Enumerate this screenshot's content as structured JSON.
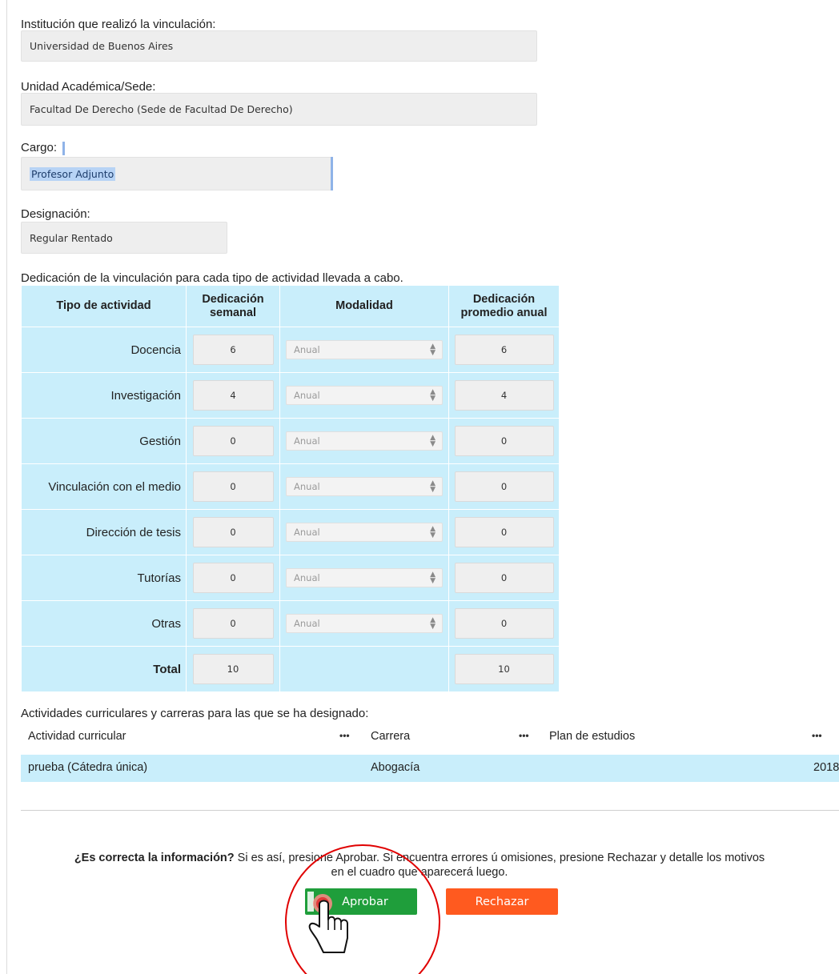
{
  "form": {
    "institucion": {
      "label": "Institución que realizó la vinculación:",
      "value": "Universidad de Buenos Aires"
    },
    "unidad": {
      "label": "Unidad Académica/Sede:",
      "value": "Facultad De Derecho (Sede de Facultad De Derecho)"
    },
    "cargo": {
      "label": "Cargo:",
      "value": "Profesor Adjunto"
    },
    "designacion": {
      "label": "Designación:",
      "value": "Regular Rentado"
    }
  },
  "dedication": {
    "caption": "Dedicación de la vinculación para cada tipo de actividad llevada a cabo.",
    "headers": {
      "tipo": "Tipo de actividad",
      "semanal_1": "Dedicación",
      "semanal_2": "semanal",
      "modalidad": "Modalidad",
      "anual_1": "Dedicación",
      "anual_2": "promedio anual"
    },
    "rows": [
      {
        "actividad": "Docencia",
        "semanal": "6",
        "modalidad": "Anual",
        "anual": "6"
      },
      {
        "actividad": "Investigación",
        "semanal": "4",
        "modalidad": "Anual",
        "anual": "4"
      },
      {
        "actividad": "Gestión",
        "semanal": "0",
        "modalidad": "Anual",
        "anual": "0"
      },
      {
        "actividad": "Vinculación con el medio",
        "semanal": "0",
        "modalidad": "Anual",
        "anual": "0"
      },
      {
        "actividad": "Dirección de tesis",
        "semanal": "0",
        "modalidad": "Anual",
        "anual": "0"
      },
      {
        "actividad": "Tutorías",
        "semanal": "0",
        "modalidad": "Anual",
        "anual": "0"
      },
      {
        "actividad": "Otras",
        "semanal": "0",
        "modalidad": "Anual",
        "anual": "0"
      }
    ],
    "total": {
      "label": "Total",
      "semanal": "10",
      "anual": "10"
    }
  },
  "curricular": {
    "caption": "Actividades curriculares y carreras para las que se ha designado:",
    "columns": {
      "actividad": "Actividad curricular",
      "carrera": "Carrera",
      "plan": "Plan de estudios",
      "menu": "•••"
    },
    "rows": [
      {
        "actividad": "prueba (Cátedra única)",
        "carrera": "Abogacía",
        "plan": "2018"
      }
    ]
  },
  "confirm": {
    "question_bold": "¿Es correcta la información?",
    "question_rest": " Si es así, presione Aprobar. Si encuentra errores ú omisiones, presione Rechazar y detalle los motivos",
    "question_line2": "en el cuadro que aparecerá luego.",
    "approve_label": "Aprobar",
    "reject_label": "Rechazar"
  },
  "colors": {
    "table_bg": "#c9eefb",
    "approve": "#1f9e3b",
    "reject": "#ff5a1f",
    "annotation": "#e00000"
  }
}
